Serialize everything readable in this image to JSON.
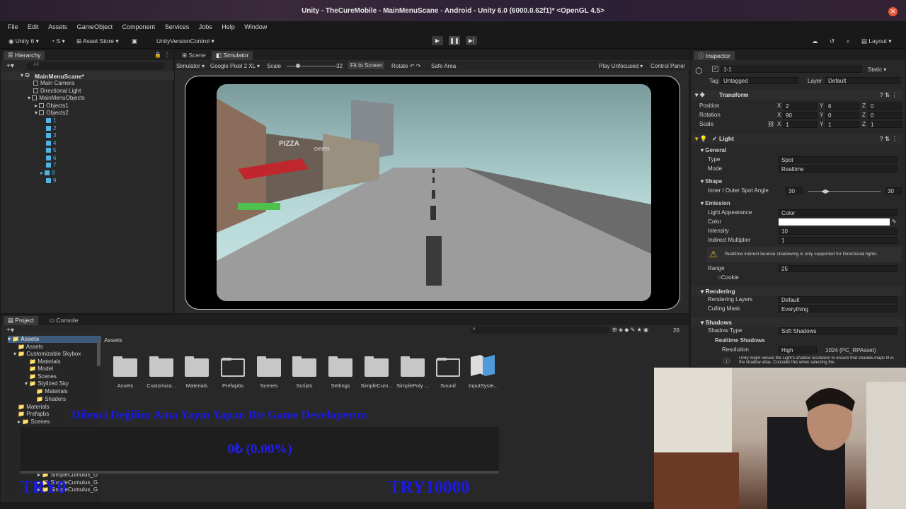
{
  "window": {
    "title": "Unity - TheCureMobile - MainMenuScane - Android - Unity 6.0 (6000.0.62f1)* <OpenGL 4.5>"
  },
  "menu": [
    "File",
    "Edit",
    "Assets",
    "GameObject",
    "Component",
    "Services",
    "Jobs",
    "Help",
    "Window"
  ],
  "toolbar": {
    "account": "Unity 6",
    "account_initial": "S",
    "asset_store": "Asset Store",
    "version_control": "UnityVersionControl",
    "layout": "Layout"
  },
  "hierarchy": {
    "tab": "Hierarchy",
    "search_placeholder": "All",
    "scene": "MainMenuScane*",
    "items": [
      "Main Camera",
      "Directional Light",
      "MainMenuObjects",
      "Objects1",
      "Objects2",
      "1",
      "2",
      "3",
      "4",
      "5",
      "6",
      "7",
      "8",
      "9"
    ]
  },
  "scene_view": {
    "tabs": [
      "Scene",
      "Simulator"
    ],
    "device_mode": "Simulator",
    "device": "Google Pixel 2 XL",
    "scale_label": "Scale",
    "scale_value": "32",
    "fit": "Fit to Screen",
    "rotate": "Rotate",
    "safe_area": "Safe Area",
    "play_mode": "Play Unfocused",
    "control_panel": "Control Panel",
    "sign1": "PIZZA",
    "sign2": "DINER"
  },
  "inspector": {
    "tab": "Inspector",
    "object_name": "1-1",
    "static": "Static",
    "tag_label": "Tag",
    "tag": "Untagged",
    "layer_label": "Layer",
    "layer": "Default",
    "transform": {
      "title": "Transform",
      "position_label": "Position",
      "rotation_label": "Rotation",
      "scale_label": "Scale",
      "position": [
        "2",
        "6",
        "0"
      ],
      "rotation": [
        "90",
        "0",
        "0"
      ],
      "scale": [
        "1",
        "1",
        "1"
      ]
    },
    "light": {
      "title": "Light",
      "general": "General",
      "type_label": "Type",
      "type": "Spot",
      "mode_label": "Mode",
      "mode": "Realtime",
      "shape": "Shape",
      "angle_label": "Inner / Outer Spot Angle",
      "inner": "30",
      "outer": "30",
      "emission": "Emission",
      "appearance_label": "Light Appearance",
      "appearance": "Color",
      "color_label": "Color",
      "intensity_label": "Intensity",
      "intensity": "10",
      "indirect_label": "Indirect Multiplier",
      "indirect": "1",
      "warning": "Realtime indirect bounce shadowing is only supported for Directional lights.",
      "range_label": "Range",
      "range": "25",
      "cookie": "Cookie",
      "rendering": "Rendering",
      "layers_label": "Rendering Layers",
      "layers": "Default",
      "culling_label": "Culling Mask",
      "culling": "Everything",
      "shadows": "Shadows",
      "shadow_type_label": "Shadow Type",
      "shadow_type": "Soft Shadows",
      "realtime_shadows": "Realtime Shadows",
      "resolution_label": "Resolution",
      "resolution": "High",
      "resolution_value": "1024 (PC_RPAsset)",
      "shadow_note": "Unity might reduce the Light's shadow resolution to ensure that shadow maps fit in the shadow atlas. Consider this when selecting the"
    }
  },
  "project": {
    "tabs": [
      "Project",
      "Console"
    ],
    "breadcrumb": "Assets",
    "count": "26",
    "tree": [
      "Assets",
      "Assets",
      "Customizable Skybox",
      "Materials",
      "Model",
      "Scenes",
      "Stylized Sky",
      "Materials",
      "Shaders",
      "Materials",
      "Prefapbs",
      "Scenes"
    ],
    "tree_bottom": [
      "SimpleCumulus_G",
      "SimpleCumulus_G",
      "SimpleCumulus_G"
    ],
    "assets": [
      "Assets",
      "Customiza...",
      "Materials",
      "Prefapbs",
      "Scenes",
      "Scripts",
      "Settings",
      "SimpleCum...",
      "SimplePoly ...",
      "Sound",
      "InputSyste..."
    ]
  },
  "overlay": {
    "banner": "Dilenci Değilim Ama Yayın Yapan Bir Game Developerım",
    "donation": "0₺ (0.00%)",
    "left": "TRY0",
    "right": "TRY10000"
  }
}
